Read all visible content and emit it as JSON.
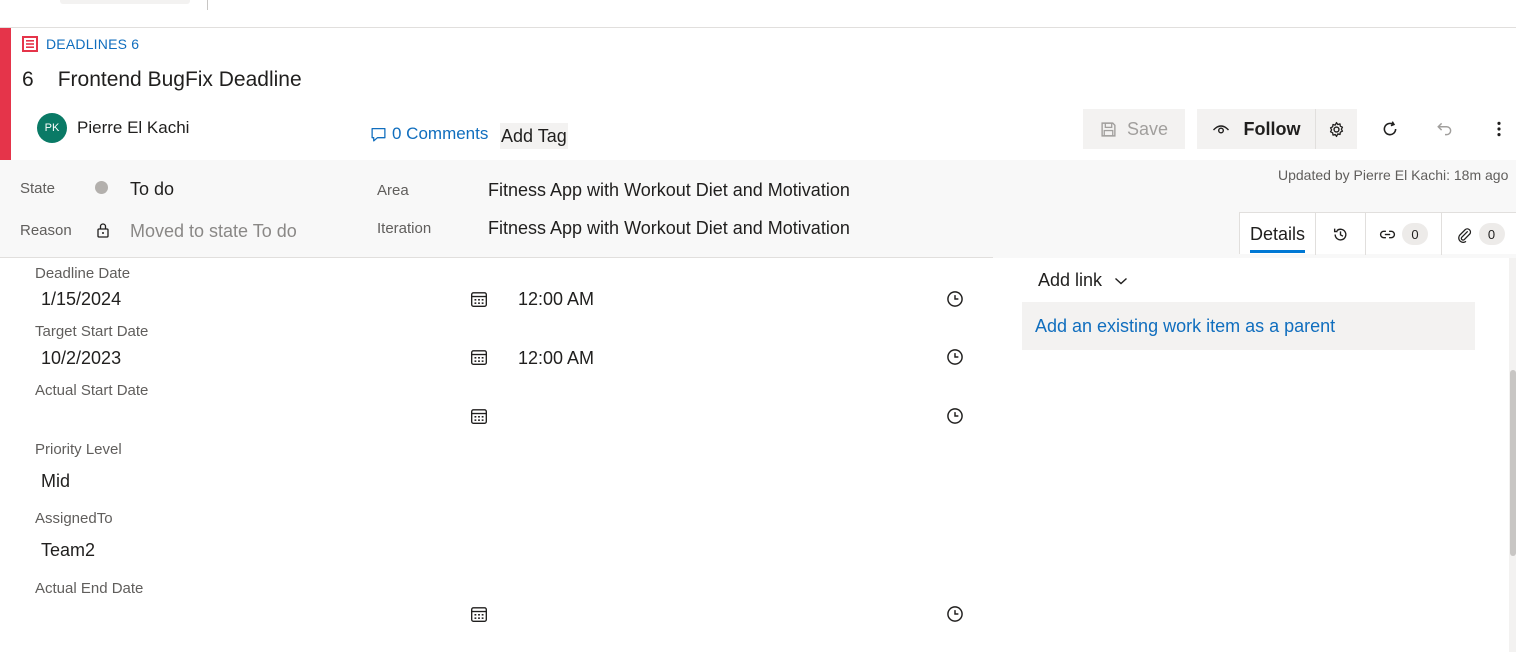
{
  "work_item": {
    "type_label": "DEADLINES 6",
    "id": "6",
    "title": "Frontend BugFix Deadline",
    "author_initials": "PK",
    "author_name": "Pierre El Kachi",
    "comments_label": "0 Comments",
    "add_tag_label": "Add Tag",
    "accent_color": "#e5344a"
  },
  "toolbar": {
    "save_label": "Save",
    "follow_label": "Follow",
    "icons": [
      "save-icon",
      "eye-icon",
      "gear-icon",
      "refresh-icon",
      "undo-icon",
      "more-icon"
    ]
  },
  "status": {
    "updated_text": "Updated by Pierre El Kachi: 18m ago"
  },
  "header_fields": {
    "state_label": "State",
    "state_value": "To do",
    "reason_label": "Reason",
    "reason_value": "Moved to state To do",
    "area_label": "Area",
    "area_value": "Fitness App with Workout Diet and Motivation",
    "iteration_label": "Iteration",
    "iteration_value": "Fitness App with Workout Diet and Motivation"
  },
  "tabs": {
    "details_label": "Details",
    "links_count": "0",
    "attachments_count": "0"
  },
  "fields": {
    "deadline_date_label": "Deadline Date",
    "deadline_date": "1/15/2024",
    "deadline_time": "12:00 AM",
    "target_start_label": "Target Start Date",
    "target_start_date": "10/2/2023",
    "target_start_time": "12:00 AM",
    "actual_start_label": "Actual Start Date",
    "priority_label": "Priority Level",
    "priority_value": "Mid",
    "assigned_label": "AssignedTo",
    "assigned_value": "Team2",
    "actual_end_label": "Actual End Date"
  },
  "related": {
    "add_link_label": "Add link",
    "parent_link_label": "Add an existing work item as a parent"
  }
}
